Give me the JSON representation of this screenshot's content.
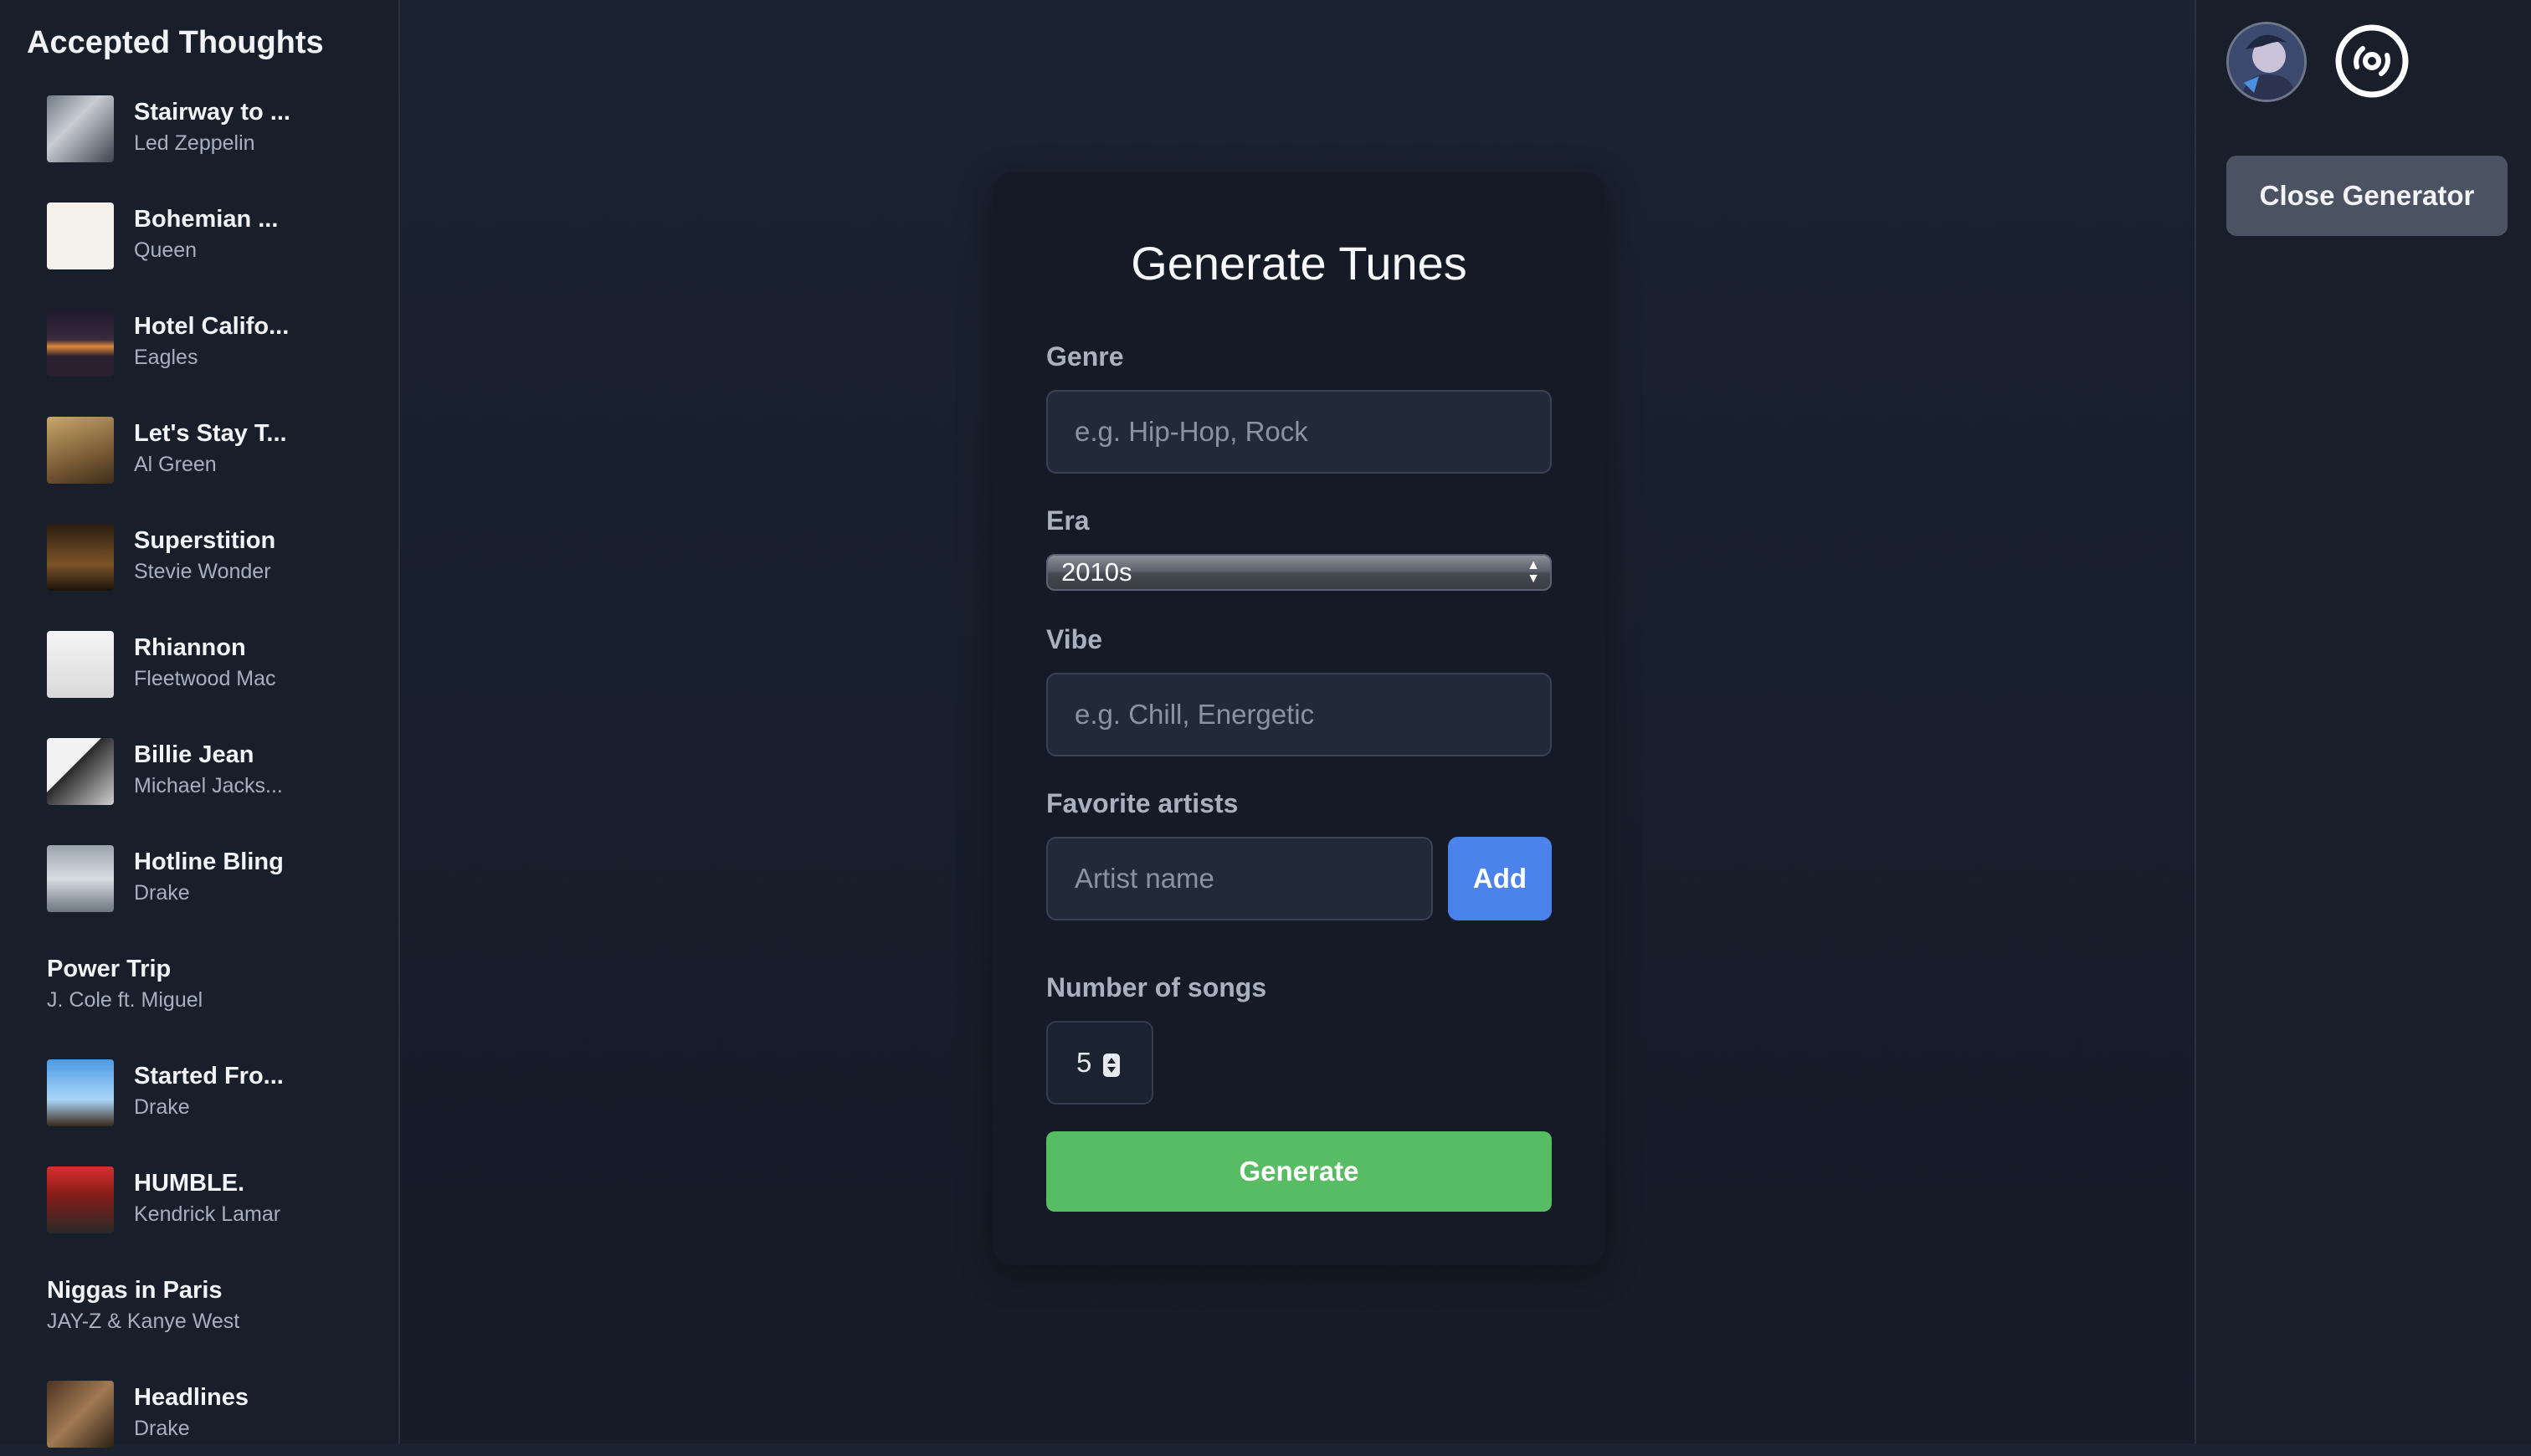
{
  "sidebar": {
    "title": "Accepted Thoughts",
    "songs": [
      {
        "title": "Stairway to ...",
        "artist": "Led Zeppelin",
        "cover": true
      },
      {
        "title": "Bohemian ...",
        "artist": "Queen",
        "cover": true
      },
      {
        "title": "Hotel Califo...",
        "artist": "Eagles",
        "cover": true
      },
      {
        "title": "Let's Stay T...",
        "artist": "Al Green",
        "cover": true
      },
      {
        "title": "Superstition",
        "artist": "Stevie Wonder",
        "cover": true
      },
      {
        "title": "Rhiannon",
        "artist": "Fleetwood Mac",
        "cover": true
      },
      {
        "title": "Billie Jean",
        "artist": "Michael Jacks...",
        "cover": true
      },
      {
        "title": "Hotline Bling",
        "artist": "Drake",
        "cover": true
      },
      {
        "title": "Power Trip",
        "artist": "J. Cole ft. Miguel",
        "cover": false
      },
      {
        "title": "Started Fro...",
        "artist": "Drake",
        "cover": true
      },
      {
        "title": "HUMBLE.",
        "artist": "Kendrick Lamar",
        "cover": true
      },
      {
        "title": "Niggas in Paris",
        "artist": "JAY-Z & Kanye West",
        "cover": false
      },
      {
        "title": "Headlines",
        "artist": "Drake",
        "cover": true
      }
    ]
  },
  "header": {
    "close_label": "Close Generator",
    "vinyl_icon": "vinyl-record-icon",
    "avatar_icon": "user-avatar"
  },
  "generator": {
    "title": "Generate Tunes",
    "genre_label": "Genre",
    "genre_placeholder": "e.g. Hip-Hop, Rock",
    "era_label": "Era",
    "era_value": "2010s",
    "vibe_label": "Vibe",
    "vibe_placeholder": "e.g. Chill, Energetic",
    "artists_label": "Favorite artists",
    "artist_placeholder": "Artist name",
    "add_label": "Add",
    "count_label": "Number of songs",
    "count_value": "5",
    "generate_label": "Generate"
  },
  "colors": {
    "background": "#1b2230",
    "panel": "#141a26",
    "accent_blue": "#4b82ec",
    "accent_green": "#57bc63",
    "close_button": "#4b5363"
  }
}
